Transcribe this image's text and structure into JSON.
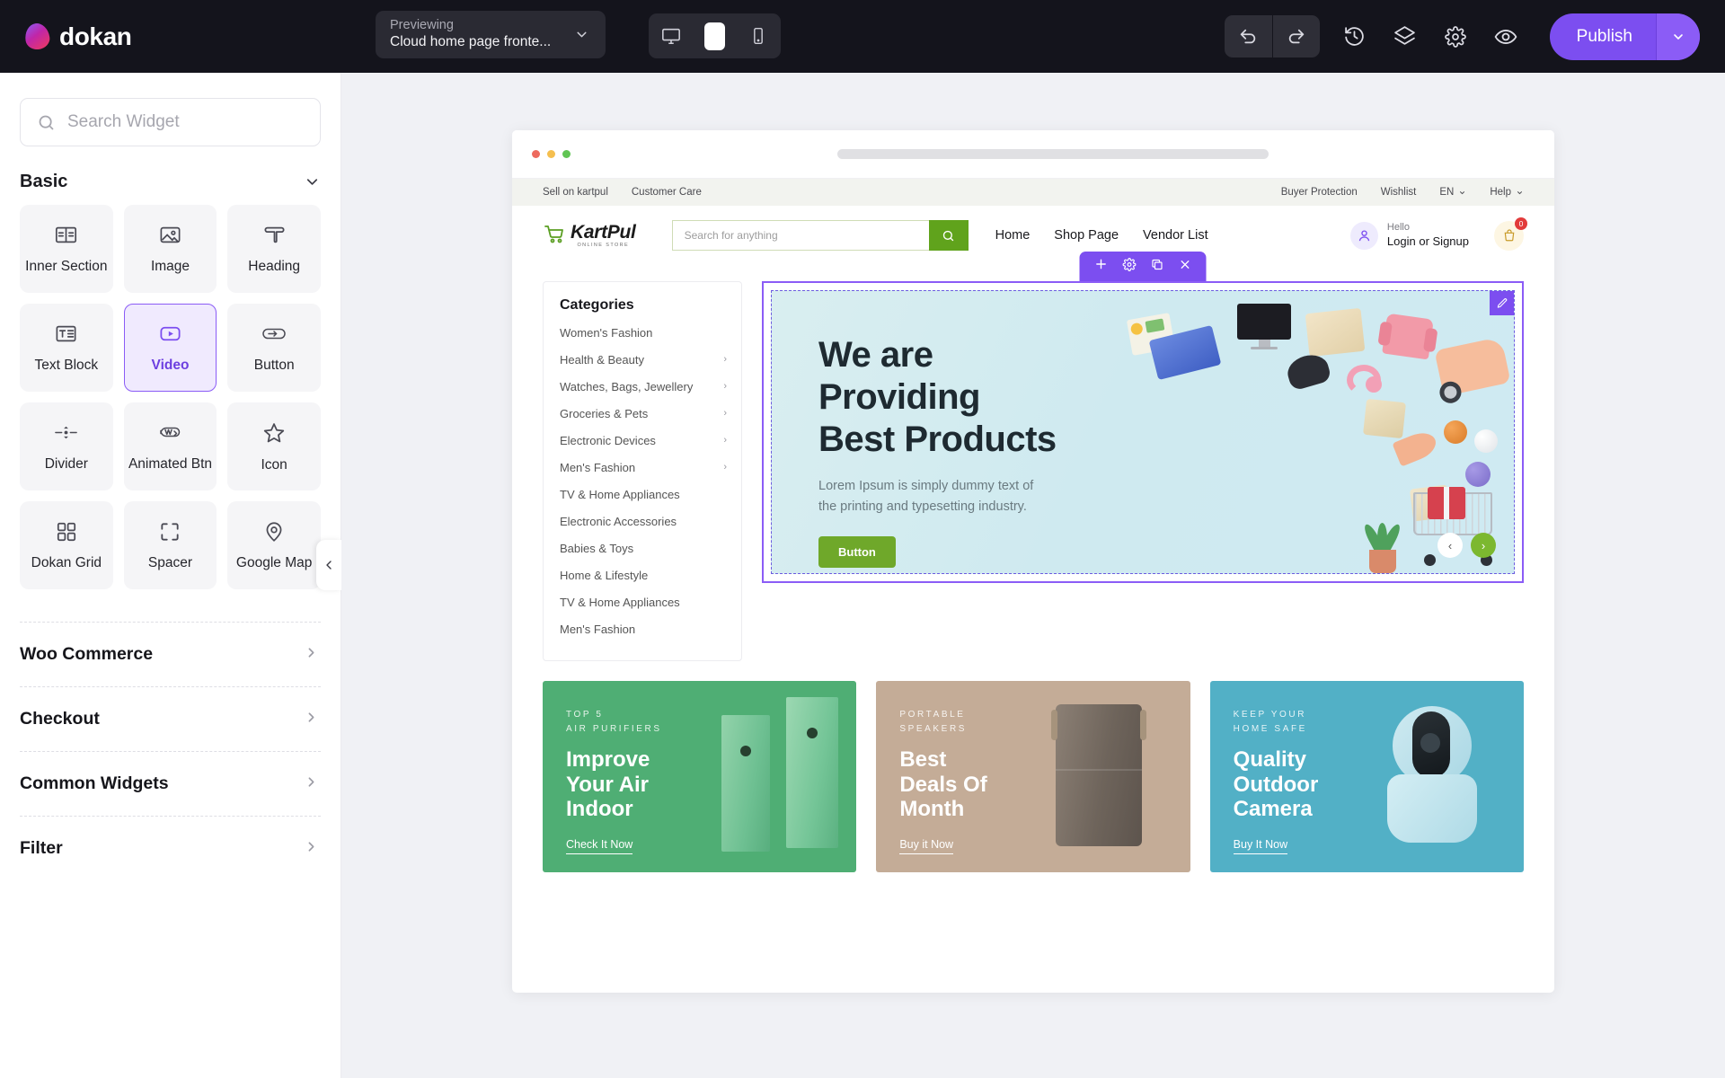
{
  "topbar": {
    "brand": "dokan",
    "previewing_label": "Previewing",
    "previewing_value": "Cloud home page fronte...",
    "device_desktop": "desktop-view",
    "device_tablet": "tablet-view",
    "device_mobile": "mobile-view",
    "undo": "undo",
    "redo": "redo",
    "history": "history",
    "layers": "layers",
    "settings": "settings",
    "preview": "preview",
    "publish_label": "Publish",
    "accent_color": "#7c4ef0"
  },
  "sidebar": {
    "search_placeholder": "Search Widget",
    "basic_title": "Basic",
    "widgets": [
      {
        "label": "Inner Section",
        "icon": "inner-section-icon",
        "selected": false
      },
      {
        "label": "Image",
        "icon": "image-icon",
        "selected": false
      },
      {
        "label": "Heading",
        "icon": "heading-icon",
        "selected": false
      },
      {
        "label": "Text Block",
        "icon": "text-block-icon",
        "selected": false
      },
      {
        "label": "Video",
        "icon": "video-icon",
        "selected": true
      },
      {
        "label": "Button",
        "icon": "button-icon",
        "selected": false
      },
      {
        "label": "Divider",
        "icon": "divider-icon",
        "selected": false
      },
      {
        "label": "Animated Btn",
        "icon": "animated-btn-icon",
        "selected": false
      },
      {
        "label": "Icon",
        "icon": "star-icon",
        "selected": false
      },
      {
        "label": "Dokan Grid",
        "icon": "grid-icon",
        "selected": false
      },
      {
        "label": "Spacer",
        "icon": "spacer-icon",
        "selected": false
      },
      {
        "label": "Google Map",
        "icon": "map-pin-icon",
        "selected": false
      }
    ],
    "sections": [
      {
        "label": "Woo Commerce"
      },
      {
        "label": "Checkout"
      },
      {
        "label": "Common Widgets"
      },
      {
        "label": "Filter"
      }
    ]
  },
  "preview": {
    "util_left": [
      "Sell on kartpul",
      "Customer Care"
    ],
    "util_right": [
      "Buyer Protection",
      "Wishlist"
    ],
    "util_lang": "EN",
    "util_help": "Help",
    "logo_main": "KartPul",
    "logo_sub": "ONLINE STORE",
    "search_placeholder": "Search for anything",
    "nav": [
      "Home",
      "Shop Page",
      "Vendor List"
    ],
    "account_hello": "Hello",
    "account_login": "Login or Signup",
    "cart_count": "0",
    "categories_title": "Categories",
    "categories": [
      {
        "label": "Women's Fashion",
        "expandable": false
      },
      {
        "label": "Health & Beauty",
        "expandable": true
      },
      {
        "label": "Watches, Bags, Jewellery",
        "expandable": true
      },
      {
        "label": "Groceries & Pets",
        "expandable": true
      },
      {
        "label": "Electronic Devices",
        "expandable": true
      },
      {
        "label": "Men's Fashion",
        "expandable": true
      },
      {
        "label": "TV & Home Appliances",
        "expandable": false
      },
      {
        "label": "Electronic Accessories",
        "expandable": false
      },
      {
        "label": "Babies & Toys",
        "expandable": false
      },
      {
        "label": "Home & Lifestyle",
        "expandable": false
      },
      {
        "label": "TV & Home Appliances",
        "expandable": false
      },
      {
        "label": "Men's Fashion",
        "expandable": false
      }
    ],
    "hero": {
      "title_line1": "We are",
      "title_line2": "Providing",
      "title_line3": "Best Products",
      "paragraph_line1": "Lorem Ipsum is simply dummy text of",
      "paragraph_line2": "the printing and typesetting industry.",
      "button_label": "Button",
      "button_color": "#6fa82a",
      "background_color": "#d3ebf0"
    },
    "promos": [
      {
        "eyebrow_line1": "TOP 5",
        "eyebrow_line2": "AIR PURIFIERS",
        "title_line1": "Improve",
        "title_line2": "Your Air",
        "title_line3": "Indoor",
        "link": "Check It Now",
        "color": "#4fae74"
      },
      {
        "eyebrow_line1": "PORTABLE",
        "eyebrow_line2": "SPEAKERS",
        "title_line1": "Best",
        "title_line2": "Deals Of",
        "title_line3": "Month",
        "link": "Buy it Now",
        "color": "#c4ac97"
      },
      {
        "eyebrow_line1": "KEEP YOUR",
        "eyebrow_line2": "HOME SAFE",
        "title_line1": "Quality",
        "title_line2": "Outdoor",
        "title_line3": "Camera",
        "link": "Buy It Now",
        "color": "#52b0c6"
      }
    ]
  }
}
